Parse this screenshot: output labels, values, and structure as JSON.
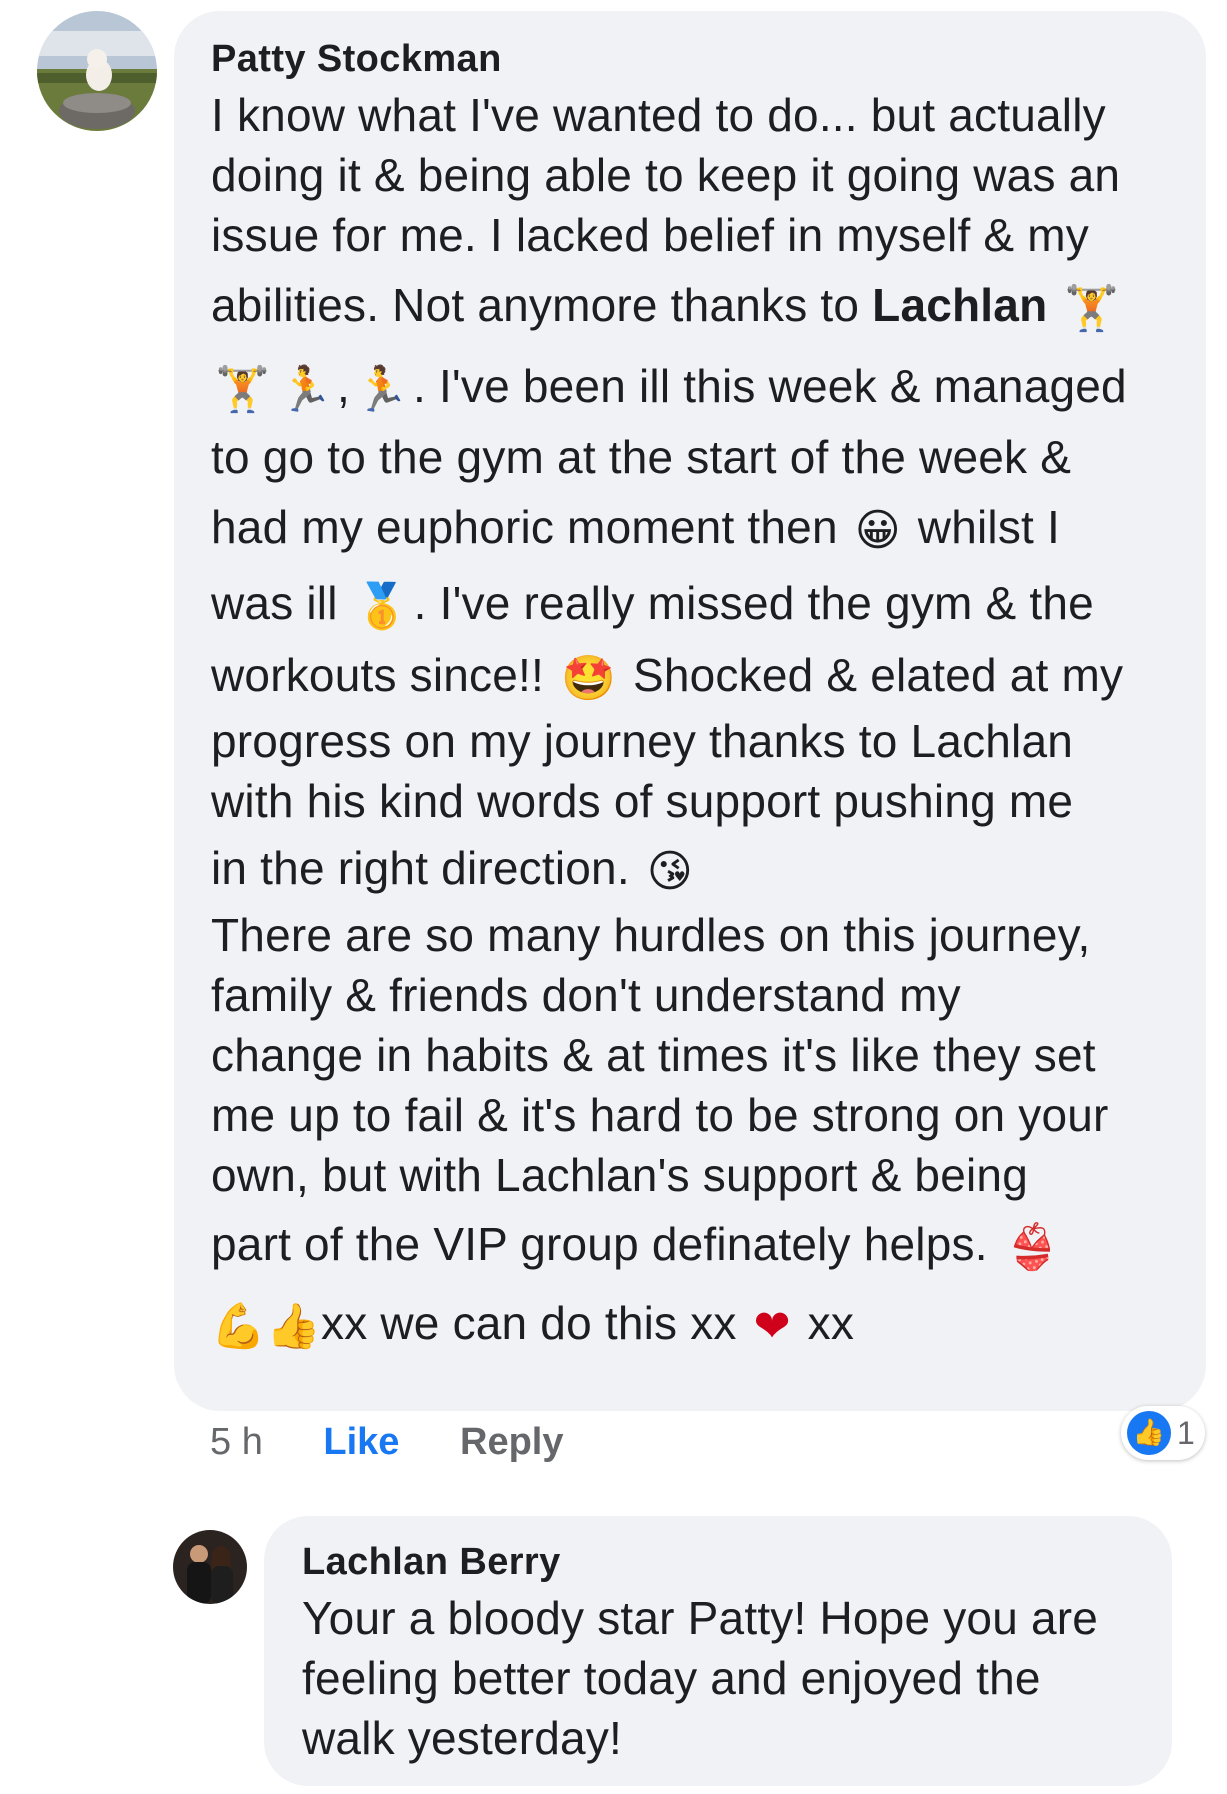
{
  "comment": {
    "author": "Patty Stockman",
    "lines": {
      "l1": "I know what I've wanted to do... but actually",
      "l2": "doing it & being able to keep it going was an",
      "l3": "issue for me. I lacked belief in myself & my",
      "l4_text": "abilities. Not anymore thanks to ",
      "l4_mention": "Lachlan",
      "l5_text": ". I've been ill this week & managed",
      "l6": "to go to the gym at the start of the week &",
      "l7_a": "had my euphoric moment then",
      "l7_b": "whilst I",
      "l8_a": "was ill",
      "l8_b": ". I've really missed the gym & the",
      "l9_a": "workouts since!!",
      "l9_b": "Shocked & elated at my",
      "l10": "progress on my journey thanks to Lachlan",
      "l11": "with his kind words of support pushing me",
      "l12": "in the right direction.",
      "l13": "There are so many hurdles on this journey,",
      "l14": "family & friends don't understand my",
      "l15": "change in habits & at times it's like they set",
      "l16": "me up to fail & it's hard to be strong on your",
      "l17": "own, but with Lachlan's support & being",
      "l18": "part of the VIP group definately helps.",
      "l19_a": "xx we can do this xx",
      "l19_b": "xx"
    },
    "emojis": {
      "weightlifter": "🏋",
      "runner_a": "🏃",
      "comma": ",",
      "runner_b": "🏃",
      "grin": "😀",
      "medal": "🥇",
      "star_struck": "🤩",
      "kiss": "😘",
      "bikini": "👙",
      "flex": "💪",
      "thumbs_up": "👍",
      "heart": "❤"
    },
    "actions": {
      "time": "5 h",
      "like": "Like",
      "reply": "Reply"
    },
    "reaction": {
      "icon": "thumbs-up-icon",
      "count": "1"
    }
  },
  "reply": {
    "author": "Lachlan Berry",
    "lines": {
      "l1": "Your a bloody star Patty! Hope you are",
      "l2": "feeling better today and enjoyed the",
      "l3": "walk yesterday!"
    }
  },
  "colors": {
    "bubble": "#f0f2f5",
    "like_blue": "#1877f2",
    "muted": "#65676b",
    "text": "#1c1e21"
  }
}
